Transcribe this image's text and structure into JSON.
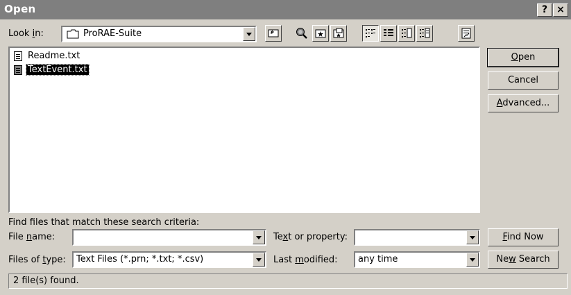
{
  "window": {
    "title": "Open",
    "help_button": "?",
    "close_button": "×"
  },
  "look_in": {
    "label_pre": "Look ",
    "label_accel": "i",
    "label_post": "n:",
    "value": "ProRAE-Suite"
  },
  "toolbar": {
    "icons": [
      "up-one-level-icon",
      "search-web-icon",
      "look-in-favorites-icon",
      "add-to-favorites-icon",
      "list-view-icon",
      "details-view-icon",
      "properties-view-icon",
      "preview-view-icon",
      "commands-and-settings-icon"
    ]
  },
  "files": [
    {
      "name": "Readme.txt",
      "selected": false
    },
    {
      "name": "TextEvent.txt",
      "selected": true
    }
  ],
  "buttons": {
    "open_accel": "O",
    "open_rest": "pen",
    "cancel": "Cancel",
    "advanced_accel": "A",
    "advanced_rest": "dvanced...",
    "find_now_accel": "F",
    "find_now_rest": "ind Now",
    "new_search_pre": "Ne",
    "new_search_accel": "w",
    "new_search_post": " Search"
  },
  "criteria": {
    "heading": "Find files that match these search criteria:",
    "file_name_pre": "File ",
    "file_name_accel": "n",
    "file_name_post": "ame:",
    "file_name_value": "",
    "text_pre": "Te",
    "text_accel": "x",
    "text_post": "t or property:",
    "text_value": "",
    "type_pre": "Files of ",
    "type_accel": "t",
    "type_post": "ype:",
    "type_value": "Text Files (*.prn; *.txt; *.csv)",
    "modified_pre": "Last ",
    "modified_accel": "m",
    "modified_post": "odified:",
    "modified_value": "any time"
  },
  "status": {
    "text": "2 file(s) found."
  },
  "colors": {
    "titlebar": "#7f7f7f",
    "face": "#d4d0c8",
    "selection": "#000000"
  }
}
